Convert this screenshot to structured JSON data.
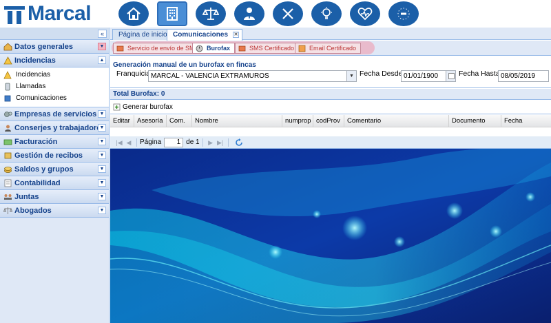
{
  "header": {
    "brand": "Marcal",
    "nav_icons": [
      {
        "name": "home-icon"
      },
      {
        "name": "building-icon",
        "active": true
      },
      {
        "name": "scales-icon"
      },
      {
        "name": "user-tie-icon"
      },
      {
        "name": "calculator-icon"
      },
      {
        "name": "lightbulb-icon"
      },
      {
        "name": "heart-pulse-icon"
      },
      {
        "name": "eu-stars-icon"
      }
    ]
  },
  "sidebar": {
    "collapse_symbol": "«",
    "sections": [
      {
        "label": "Datos generales",
        "icon": "house-icon",
        "highlight": true
      },
      {
        "label": "Incidencias",
        "icon": "warning-icon",
        "expanded": true,
        "items": [
          {
            "label": "Incidencias",
            "icon": "warning-icon"
          },
          {
            "label": "Llamadas",
            "icon": "phone-icon"
          },
          {
            "label": "Comunicaciones",
            "icon": "message-icon"
          }
        ]
      },
      {
        "label": "Empresas de servicios",
        "icon": "gears-icon"
      },
      {
        "label": "Conserjes y trabajadores",
        "icon": "people-icon"
      },
      {
        "label": "Facturación",
        "icon": "money-icon"
      },
      {
        "label": "Gestión de recibos",
        "icon": "receipt-icon"
      },
      {
        "label": "Saldos y grupos",
        "icon": "coins-icon"
      },
      {
        "label": "Contabilidad",
        "icon": "ledger-icon"
      },
      {
        "label": "Juntas",
        "icon": "meeting-icon"
      },
      {
        "label": "Abogados",
        "icon": "scales-icon"
      }
    ]
  },
  "tabs": [
    {
      "label": "Página de inicio",
      "active": false
    },
    {
      "label": "Comunicaciones",
      "active": true
    }
  ],
  "subtabs": [
    {
      "label": "Servicio de envío de SMS",
      "active": false
    },
    {
      "label": "Burofax",
      "active": true
    },
    {
      "label": "SMS Certificado",
      "active": false
    },
    {
      "label": "Email Certificado",
      "active": false
    }
  ],
  "form": {
    "title": "Generación manual de un burofax en fincas",
    "franquicia_label": "Franquicia",
    "franquicia_value": "MARCAL - VALENCIA EXTRAMUROS",
    "desde_label": "Fecha Desde",
    "desde_value": "01/01/1900",
    "hasta_label": "Fecha Hasta",
    "hasta_value": "08/05/2019"
  },
  "grid": {
    "total": "Total Burofax: 0",
    "generate_label": "Generar burofax",
    "columns": [
      "Editar",
      "Asesoría",
      "Com.",
      "Nombre",
      "numprop",
      "codProv",
      "Comentario",
      "Documento",
      "Fecha"
    ]
  },
  "pager": {
    "page_label": "Página",
    "page_value": "1",
    "of_label": "de 1"
  },
  "colors": {
    "brand": "#1b5fa8",
    "panel": "#dfe8f6",
    "border": "#99bbe8",
    "highlight": "#f096aa"
  }
}
